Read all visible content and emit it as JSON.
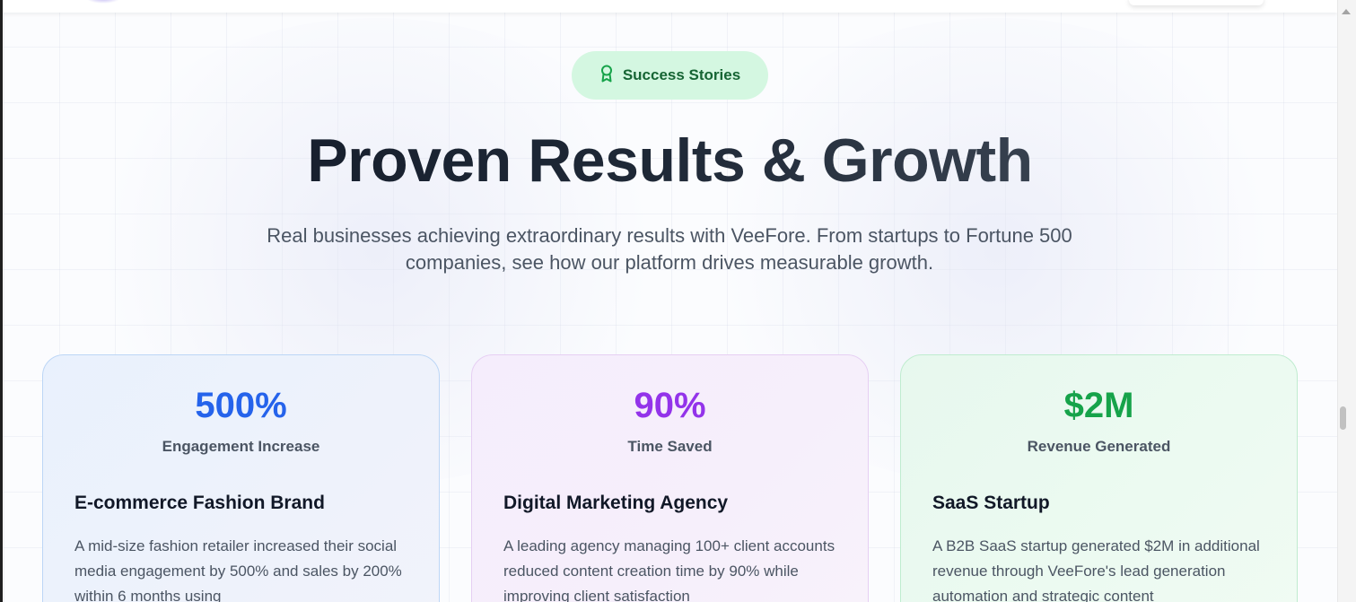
{
  "badge": {
    "label": "Success Stories",
    "icon": "award-icon"
  },
  "hero": {
    "title": "Proven Results & Growth",
    "subtitle": "Real businesses achieving extraordinary results with VeeFore. From startups to Fortune 500 companies, see how our platform drives measurable growth."
  },
  "cards": [
    {
      "stat": "500%",
      "stat_label": "Engagement Increase",
      "title": "E-commerce Fashion Brand",
      "description": "A mid-size fashion retailer increased their social media engagement by 500% and sales by 200% within 6 months using",
      "accent": "#2563eb"
    },
    {
      "stat": "90%",
      "stat_label": "Time Saved",
      "title": "Digital Marketing Agency",
      "description": "A leading agency managing 100+ client accounts reduced content creation time by 90% while improving client satisfaction",
      "accent": "#9333ea"
    },
    {
      "stat": "$2M",
      "stat_label": "Revenue Generated",
      "title": "SaaS Startup",
      "description": "A B2B SaaS startup generated $2M in additional revenue through VeeFore's lead generation automation and strategic content",
      "accent": "#16a34a"
    }
  ],
  "colors": {
    "badge_bg": "#d4f7e1",
    "badge_text": "#166534"
  }
}
